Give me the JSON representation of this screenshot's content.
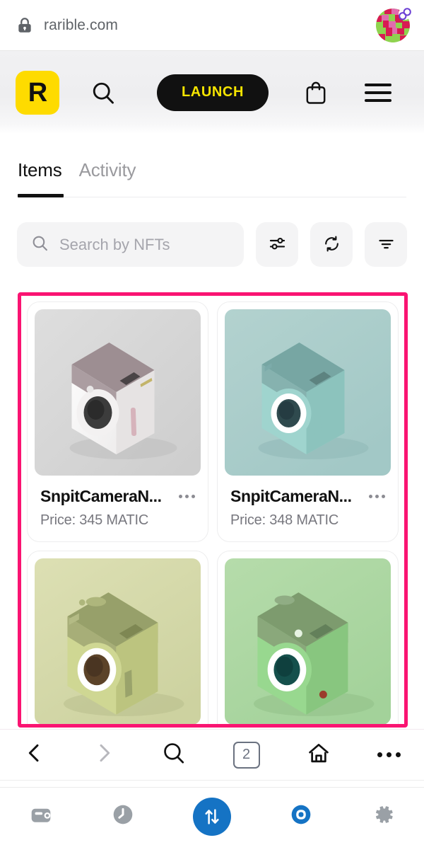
{
  "browser": {
    "url": "rarible.com",
    "lock_icon": "lock-icon",
    "avatar_icon": "profile-avatar",
    "avatar_badge_icon": "infinity-badge-icon",
    "nav": {
      "back_icon": "chevron-left-icon",
      "forward_icon": "chevron-right-icon",
      "search_icon": "search-icon",
      "tab_count": "2",
      "home_icon": "home-icon",
      "more_icon": "more-horizontal-icon"
    }
  },
  "header": {
    "logo_letter": "R",
    "logo_color": "#FEDB00",
    "search_icon": "search-icon",
    "launch_label": "LAUNCH",
    "launch_bg": "#111111",
    "launch_text_color": "#F5E400",
    "bag_icon": "shopping-bag-icon",
    "menu_icon": "hamburger-menu-icon"
  },
  "tabs": [
    {
      "label": "Items",
      "active": true
    },
    {
      "label": "Activity",
      "active": false
    }
  ],
  "toolbar": {
    "search_placeholder": "Search by NFTs",
    "search_value": "",
    "search_icon": "search-icon",
    "sliders_icon": "sliders-filter-icon",
    "refresh_icon": "refresh-sync-icon",
    "filter_icon": "filter-lines-icon"
  },
  "highlight": {
    "color": "#FA1472"
  },
  "items": [
    {
      "title": "SnpitCameraN...",
      "price": "Price: 345 MATIC",
      "bg": "#d6d6d6",
      "body": "#f2f0f0",
      "top": "#9d8e92",
      "accent": "#cfa9b0",
      "lens": "#3a3a3a",
      "more_icon": "more-options-icon"
    },
    {
      "title": "SnpitCameraN...",
      "price": "Price: 348 MATIC",
      "bg": "#a9cbc9",
      "body": "#9fd4ce",
      "top": "#76a5a2",
      "accent": "#ffffff",
      "lens": "#2f4a4e",
      "more_icon": "more-options-icon"
    },
    {
      "title": "",
      "price": "",
      "bg": "#d7dba9",
      "body": "#cfd793",
      "top": "#97a06a",
      "accent": "#ffffff",
      "lens": "#5c4329",
      "more_icon": "more-options-icon"
    },
    {
      "title": "",
      "price": "",
      "bg": "#aed7a5",
      "body": "#98d88f",
      "top": "#7d9b6e",
      "accent": "#ffffff",
      "lens": "#15504c",
      "more_icon": "more-options-icon"
    }
  ],
  "app_bar": {
    "wallet_icon": "wallet-icon",
    "history_icon": "clock-history-icon",
    "swap_icon": "swap-arrows-icon",
    "browser_icon": "compass-browser-icon",
    "settings_icon": "gear-settings-icon",
    "accent": "#1573C4"
  }
}
